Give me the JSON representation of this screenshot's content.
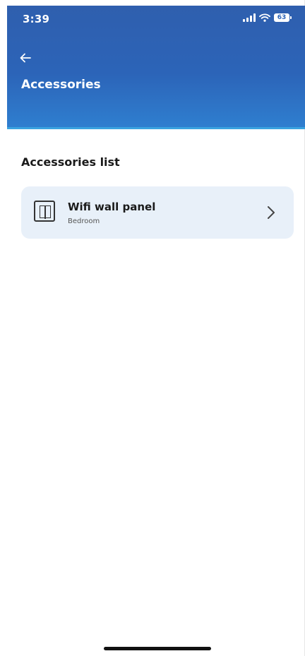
{
  "status_bar": {
    "time": "3:39",
    "battery": "63"
  },
  "header": {
    "title": "Accessories",
    "back_icon": "arrow-left-icon",
    "color": "#2c64b8"
  },
  "section": {
    "title": "Accessories list"
  },
  "accessories": [
    {
      "name": "Wifi wall panel",
      "room": "Bedroom",
      "icon": "wall-panel-icon"
    }
  ]
}
